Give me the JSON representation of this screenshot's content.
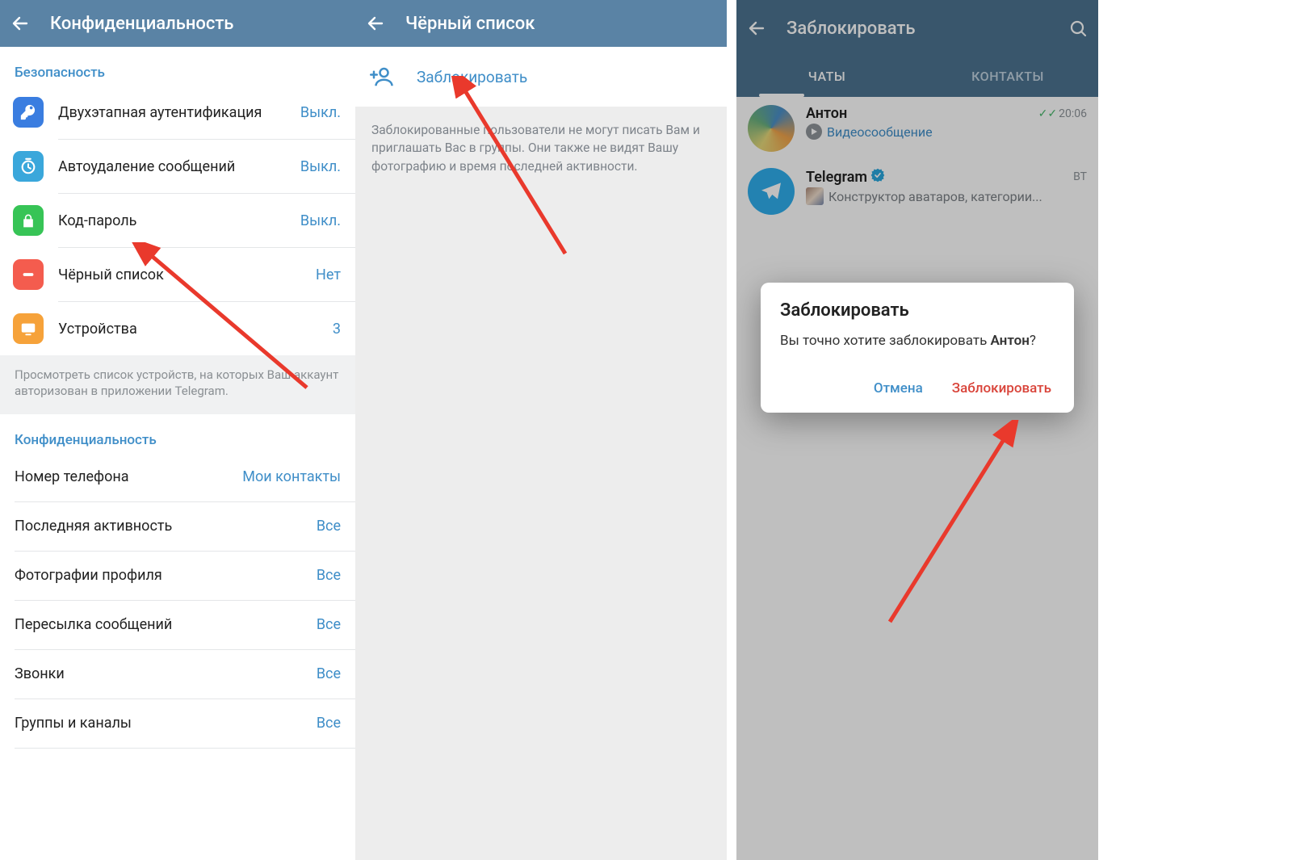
{
  "screen1": {
    "title": "Конфиденциальность",
    "section_security": "Безопасность",
    "items_security": {
      "two_step": {
        "label": "Двухэтапная аутентификация",
        "value": "Выкл."
      },
      "autodelete": {
        "label": "Автоудаление сообщений",
        "value": "Выкл."
      },
      "passcode": {
        "label": "Код-пароль",
        "value": "Выкл."
      },
      "blacklist": {
        "label": "Чёрный список",
        "value": "Нет"
      },
      "devices": {
        "label": "Устройства",
        "value": "3"
      }
    },
    "security_footer": "Просмотреть список устройств, на которых Ваш аккаунт авторизован в приложении Telegram.",
    "section_privacy": "Конфиденциальность",
    "items_privacy": {
      "phone": {
        "label": "Номер телефона",
        "value": "Мои контакты"
      },
      "lastseen": {
        "label": "Последняя активность",
        "value": "Все"
      },
      "photos": {
        "label": "Фотографии профиля",
        "value": "Все"
      },
      "forward": {
        "label": "Пересылка сообщений",
        "value": "Все"
      },
      "calls": {
        "label": "Звонки",
        "value": "Все"
      },
      "groups": {
        "label": "Группы и каналы",
        "value": "Все"
      }
    }
  },
  "screen2": {
    "title": "Чёрный список",
    "action_label": "Заблокировать",
    "info": "Заблокированные пользователи не могут писать Вам и приглашать Вас в группы. Они также не видят Вашу фотографию и время последней активности."
  },
  "screen3": {
    "title": "Заблокировать",
    "tabs": {
      "chats": "ЧАТЫ",
      "contacts": "КОНТАКТЫ"
    },
    "chats": {
      "anton": {
        "name": "Антон",
        "subtitle": "Видеосообщение",
        "time": "20:06"
      },
      "telegram": {
        "name": "Telegram",
        "subtitle": "Конструктор аватаров, категории...",
        "time": "ВТ"
      }
    },
    "dialog": {
      "title": "Заблокировать",
      "body_prefix": "Вы точно хотите заблокировать ",
      "body_name": "Антон",
      "body_suffix": "?",
      "cancel": "Отмена",
      "confirm": "Заблокировать"
    }
  }
}
